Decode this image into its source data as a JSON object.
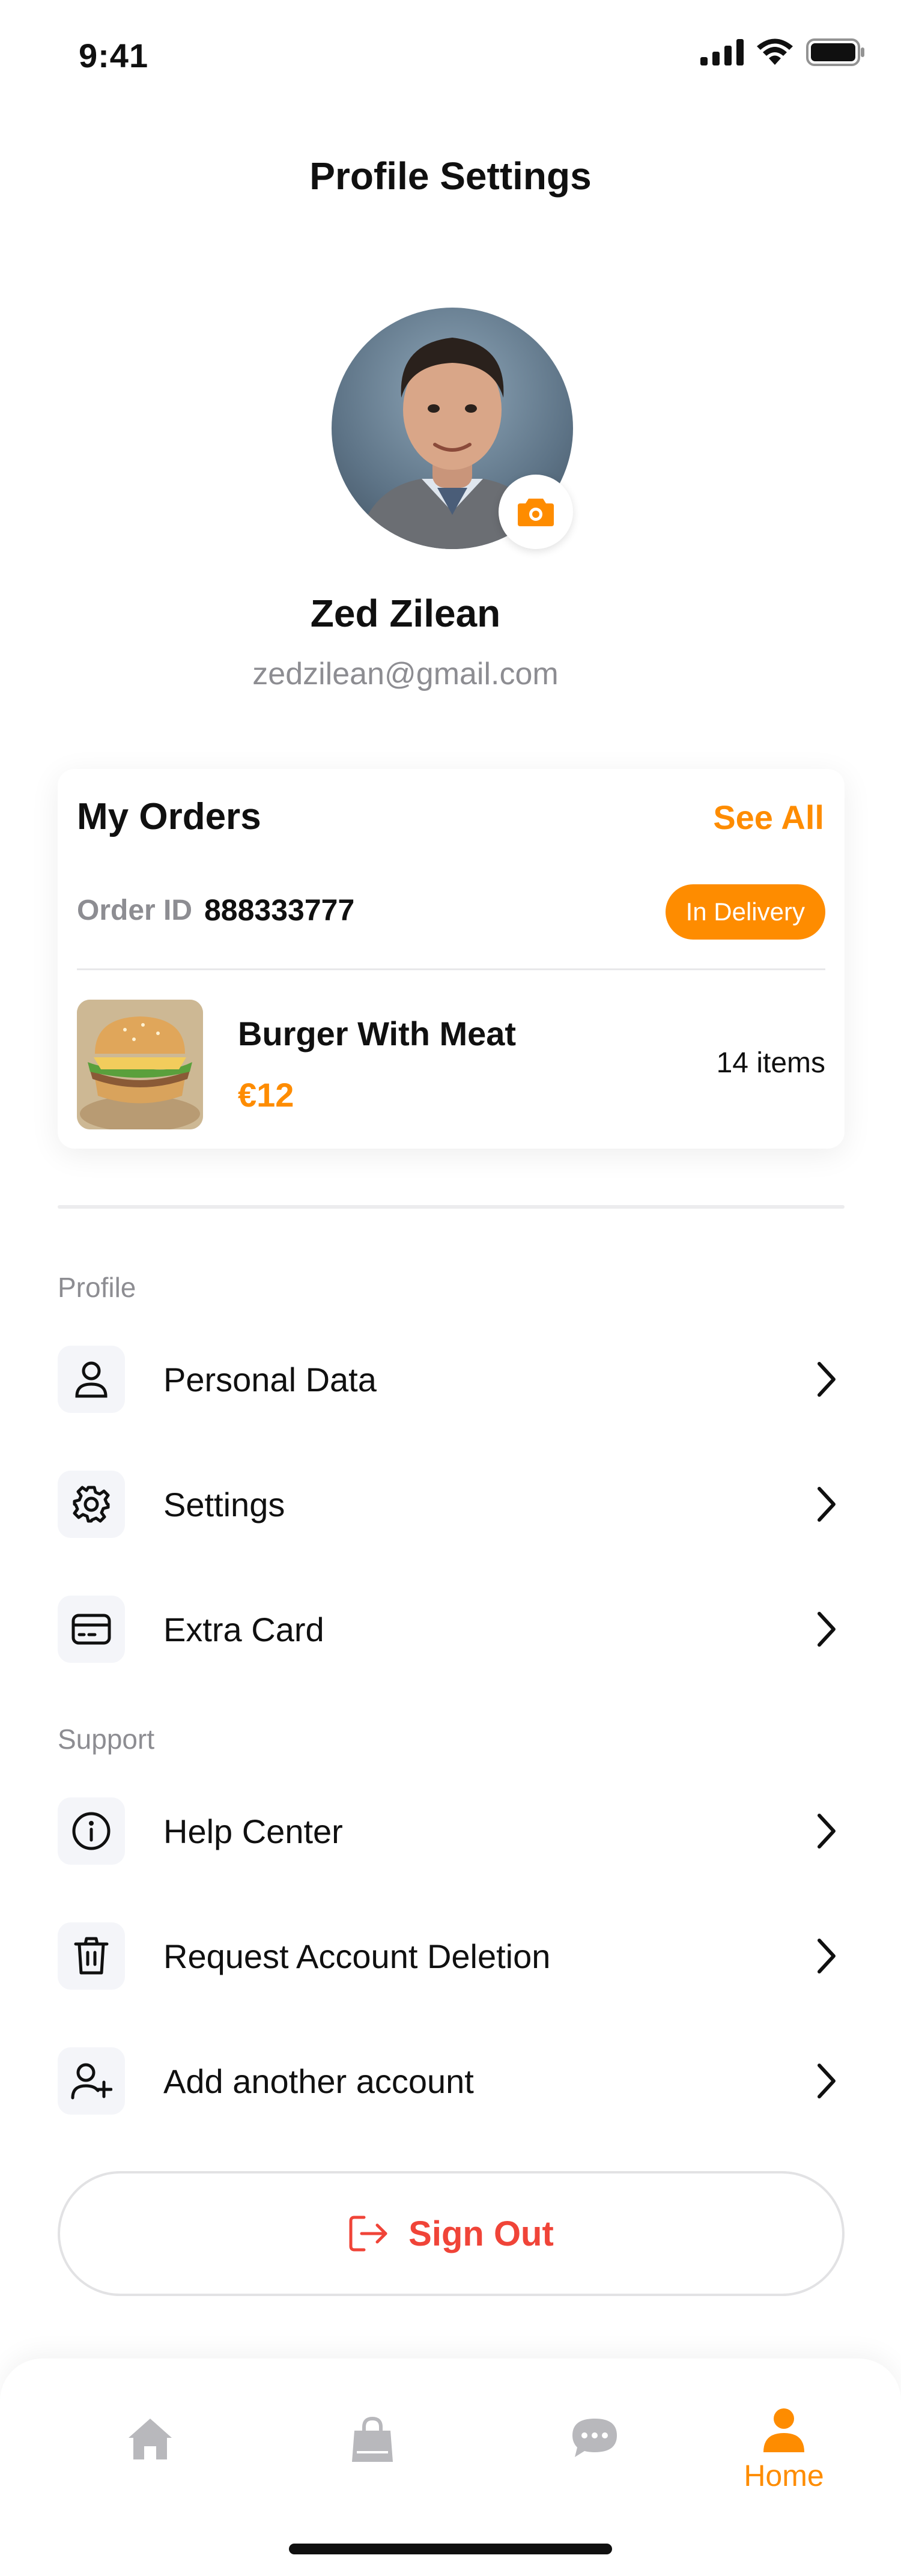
{
  "status_bar": {
    "time": "9:41"
  },
  "header": {
    "title": "Profile Settings"
  },
  "profile": {
    "name": "Zed Zilean",
    "email": "zedzilean@gmail.com"
  },
  "orders": {
    "title": "My Orders",
    "see_all": "See All",
    "order_id_label": "Order ID",
    "order_id": "888333777",
    "status": "In Delivery",
    "item_name": "Burger With Meat",
    "item_price": "€12",
    "item_count": "14 items"
  },
  "sections": {
    "profile_label": "Profile",
    "support_label": "Support",
    "profile_items": [
      {
        "label": "Personal Data",
        "icon": "user-icon"
      },
      {
        "label": "Settings",
        "icon": "gear-icon"
      },
      {
        "label": "Extra Card",
        "icon": "card-icon"
      }
    ],
    "support_items": [
      {
        "label": "Help Center",
        "icon": "info-icon"
      },
      {
        "label": "Request Account Deletion",
        "icon": "trash-icon"
      },
      {
        "label": "Add another account",
        "icon": "user-plus-icon"
      }
    ]
  },
  "sign_out": {
    "label": "Sign Out"
  },
  "bottom_nav": {
    "active_label": "Home"
  },
  "colors": {
    "accent": "#fe8c00",
    "danger": "#f04438",
    "muted": "#8d8d92",
    "icon_inactive": "#b8b8bc"
  }
}
